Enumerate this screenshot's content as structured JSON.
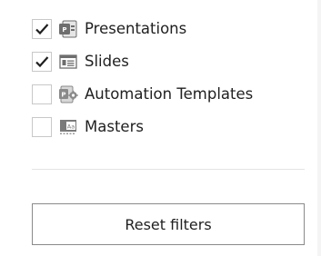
{
  "filters": [
    {
      "label": "Presentations",
      "checked": true,
      "icon": "presentation-icon"
    },
    {
      "label": "Slides",
      "checked": true,
      "icon": "slide-icon"
    },
    {
      "label": "Automation Templates",
      "checked": false,
      "icon": "automation-template-icon"
    },
    {
      "label": "Masters",
      "checked": false,
      "icon": "master-icon"
    }
  ],
  "reset_label": "Reset filters",
  "colors": {
    "checkmark": "#1f1f1f",
    "checkbox_border": "#c8c8c8",
    "button_border": "#8a8a8a",
    "icon_gray": "#6e6e6e"
  }
}
